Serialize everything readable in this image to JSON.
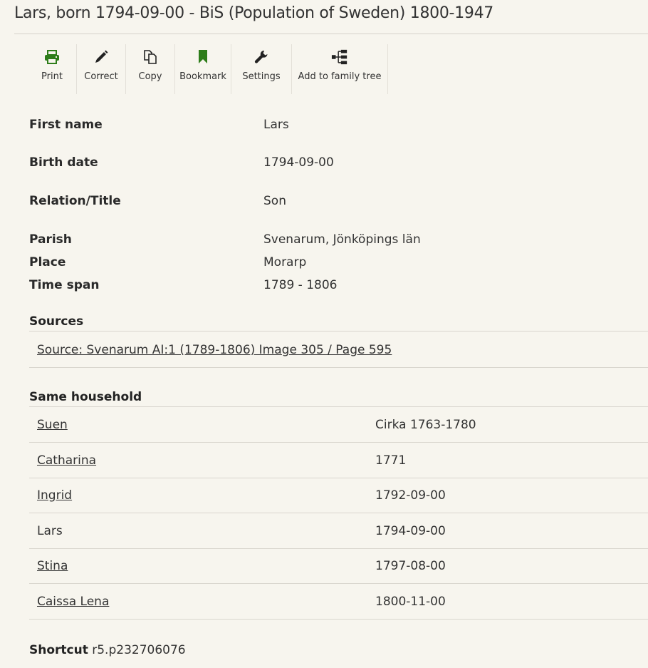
{
  "page": {
    "title": "Lars, born 1794-09-00 - BiS (Population of Sweden) 1800-1947"
  },
  "toolbar": {
    "print": "Print",
    "correct": "Correct",
    "copy": "Copy",
    "bookmark": "Bookmark",
    "settings": "Settings",
    "add_tree": "Add to family tree",
    "accent_color": "#2e7d1a"
  },
  "facts": {
    "first_name_label": "First name",
    "first_name_value": "Lars",
    "birth_date_label": "Birth date",
    "birth_date_value": "1794-09-00",
    "relation_label": "Relation/Title",
    "relation_value": "Son",
    "parish_label": "Parish",
    "parish_value": "Svenarum, Jönköpings län",
    "place_label": "Place",
    "place_value": "Morarp",
    "timespan_label": "Time span",
    "timespan_value": "1789 - 1806"
  },
  "sources": {
    "heading": "Sources",
    "link": "Source: Svenarum AI:1 (1789-1806) Image 305 / Page 595"
  },
  "household": {
    "heading": "Same household",
    "members": [
      {
        "name": "Suen",
        "date": "Cirka 1763-1780"
      },
      {
        "name": "Catharina",
        "date": "1771"
      },
      {
        "name": "Ingrid",
        "date": "1792-09-00"
      },
      {
        "name": "Lars",
        "date": "1794-09-00"
      },
      {
        "name": "Stina",
        "date": "1797-08-00"
      },
      {
        "name": "Caissa Lena",
        "date": "1800-11-00"
      }
    ]
  },
  "shortcut": {
    "label": "Shortcut",
    "value": "r5.p232706076"
  }
}
